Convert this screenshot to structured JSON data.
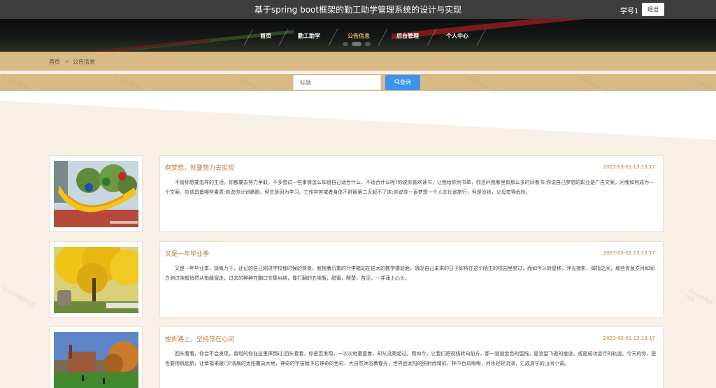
{
  "header": {
    "title": "基于spring boot框架的勤工助学管理系统的设计与实现",
    "user": "学号1",
    "logout": "退出"
  },
  "nav": {
    "items": [
      "首页",
      "勤工助学",
      "公告信息",
      "后台管理",
      "个人中心"
    ],
    "active_index": 2
  },
  "breadcrumb": {
    "home": "首页",
    "current": "公告信息"
  },
  "search": {
    "placeholder": "标题",
    "button": "查询"
  },
  "notices": [
    {
      "title": "有梦想，就要努力去实现",
      "time": "2023-03-01 13:13:17",
      "text": "不管你想要怎样的生活，你都要去努力争取，不多尝试一些事情怎么知道自己适合什么、不适合什么呢?你说你喜欢读书，让我给你列书单，你还问我哪里有那么多时间看书;你说自己梦想的职业是广告文案，问我如何成为一个文案，应该具备哪些素质;你说你计划晨跑，但总是因为学习、工作辛苦或者身体不舒服第二天起不了床;你说你一直梦想一个人去长途旅行，但是没钱，父母觉得危险。",
      "image": "sculpture"
    },
    {
      "title": "又是一年毕业季",
      "time": "2023-03-01 13:13:17",
      "text": "又是一年毕业季，感慨万千，还记的自己刚进学校那时候的情景，我拖着沉重的行李箱站在偌大的教学楼前面，感叹自己未来的日子即将在这个陌生的校园里度过，而如今斗转星移，浮光掠影，弹指之间，那些青葱岁月如同白驹过隙般悄然从指缝溜走。过去的种种在胸口交集纠结，像打翻的五味瓶，甜蜜，酸楚，苦涩，一并涌上心头。",
      "image": "yellow-tree"
    },
    {
      "title": "挫折路上，坚持常在心间",
      "time": "2023-03-01 13:13:17",
      "text": "回头看看，你会不会发现，曾经的你在这里摔倒过;回头看看，你是否发现，一次次地重复着，却从没爬起过。而如今，让我们把视线转向前方，那一道道金色的弧线，是流星飞逝的痕迹，或是成功运行的轨道。今天的你，是否要扬帆起航，让幸福来敲门?清晨的太阳撒向大地，神奇的宇宙赋予它神奇的色彩，大自然沐浴着春光，世界因太阳的照射而精彩，林中百鸟啾啾，河水轻轻流淌，汇成清宁的山间小调。",
      "image": "campus-lawn"
    }
  ],
  "watermark": "Qrcode程序代写",
  "colors": {
    "accent": "#c27a3a",
    "band": "#d9ba85",
    "button": "#3d94f0",
    "topbar": "#3d3d3d"
  }
}
